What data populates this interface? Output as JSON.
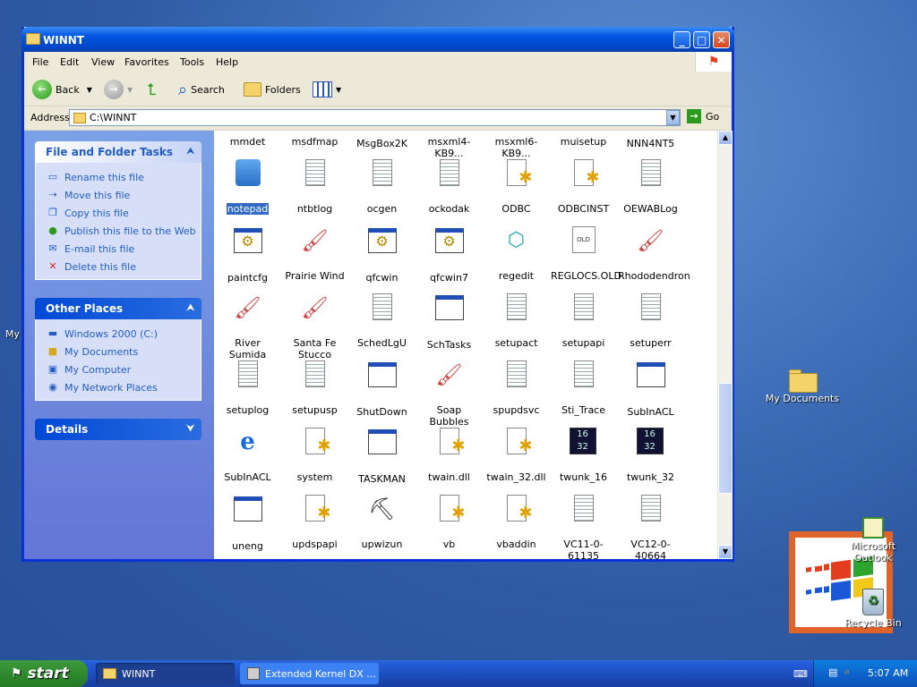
{
  "desktop": {
    "my_documents_label": "My Documents",
    "outlook_label": "Microsoft Outlook",
    "recycle_label": "Recycle Bin",
    "cut_label": "My"
  },
  "window": {
    "title": "WINNT",
    "menu": [
      "File",
      "Edit",
      "View",
      "Favorites",
      "Tools",
      "Help"
    ],
    "toolbar": {
      "back": "Back",
      "search": "Search",
      "folders": "Folders"
    },
    "address_label": "Address",
    "address_value": "C:\\WINNT",
    "go_label": "Go"
  },
  "tasks": {
    "file_folder": {
      "title": "File and Folder Tasks",
      "items": [
        "Rename this file",
        "Move this file",
        "Copy this file",
        "Publish this file to the Web",
        "E-mail this file",
        "Delete this file"
      ]
    },
    "other_places": {
      "title": "Other Places",
      "items": [
        "Windows 2000 (C:)",
        "My Documents",
        "My Computer",
        "My Network Places"
      ]
    },
    "details": {
      "title": "Details"
    }
  },
  "files": [
    {
      "name": "mmdet",
      "icon": "doc-icon"
    },
    {
      "name": "msdfmap",
      "icon": "doc-icon"
    },
    {
      "name": "MsgBox2K",
      "icon": "window-icon"
    },
    {
      "name": "msxml4-KB9...",
      "icon": "doc-icon"
    },
    {
      "name": "msxml6-KB9...",
      "icon": "doc-icon"
    },
    {
      "name": "muisetup",
      "icon": "doc-icon"
    },
    {
      "name": "NNN4NT5",
      "icon": "tool-icon"
    },
    {
      "name": "notepad",
      "icon": "notepad-icon",
      "selected": true
    },
    {
      "name": "ntbtlog",
      "icon": "doc-icon"
    },
    {
      "name": "ocgen",
      "icon": "doc-icon"
    },
    {
      "name": "ockodak",
      "icon": "doc-icon"
    },
    {
      "name": "ODBC",
      "icon": "config-icon"
    },
    {
      "name": "ODBCINST",
      "icon": "config-icon"
    },
    {
      "name": "OEWABLog",
      "icon": "doc-icon"
    },
    {
      "name": "paintcfg",
      "icon": "gear-window-icon"
    },
    {
      "name": "Prairie Wind",
      "icon": "brush-icon"
    },
    {
      "name": "qfcwin",
      "icon": "gear-window-icon"
    },
    {
      "name": "qfcwin7",
      "icon": "gear-window-icon"
    },
    {
      "name": "regedit",
      "icon": "registry-icon"
    },
    {
      "name": "REGLOCS.OLD",
      "icon": "old-file-icon"
    },
    {
      "name": "Rhododendron",
      "icon": "brush-icon"
    },
    {
      "name": "River Sumida",
      "icon": "brush-icon"
    },
    {
      "name": "Santa Fe Stucco",
      "icon": "brush-icon"
    },
    {
      "name": "SchedLgU",
      "icon": "doc-icon"
    },
    {
      "name": "SchTasks",
      "icon": "window-icon"
    },
    {
      "name": "setupact",
      "icon": "doc-icon"
    },
    {
      "name": "setupapi",
      "icon": "doc-icon"
    },
    {
      "name": "setuperr",
      "icon": "doc-icon"
    },
    {
      "name": "setuplog",
      "icon": "doc-icon"
    },
    {
      "name": "setupusp",
      "icon": "doc-icon"
    },
    {
      "name": "ShutDown",
      "icon": "window-icon"
    },
    {
      "name": "Soap Bubbles",
      "icon": "brush-icon"
    },
    {
      "name": "spupdsvc",
      "icon": "doc-icon"
    },
    {
      "name": "Sti_Trace",
      "icon": "doc-icon"
    },
    {
      "name": "SubInACL",
      "icon": "window-icon"
    },
    {
      "name": "SubInACL",
      "icon": "ie-icon"
    },
    {
      "name": "system",
      "icon": "config-icon"
    },
    {
      "name": "TASKMAN",
      "icon": "window-icon"
    },
    {
      "name": "twain.dll",
      "icon": "config-icon"
    },
    {
      "name": "twain_32.dll",
      "icon": "config-icon"
    },
    {
      "name": "twunk_16",
      "icon": "dos-icon"
    },
    {
      "name": "twunk_32",
      "icon": "dos-icon"
    },
    {
      "name": "uneng",
      "icon": "window-icon"
    },
    {
      "name": "updspapi",
      "icon": "config-icon"
    },
    {
      "name": "upwizun",
      "icon": "pick-icon"
    },
    {
      "name": "vb",
      "icon": "config-icon"
    },
    {
      "name": "vbaddin",
      "icon": "config-icon"
    },
    {
      "name": "VC11-0-61135",
      "icon": "doc-icon"
    },
    {
      "name": "VC12-0-40664",
      "icon": "doc-icon"
    }
  ],
  "taskbar": {
    "start_label": "start",
    "tasks": [
      {
        "label": "WINNT",
        "active": true
      },
      {
        "label": "Extended Kernel DX ...",
        "active": false
      }
    ],
    "clock": "5:07 AM"
  }
}
